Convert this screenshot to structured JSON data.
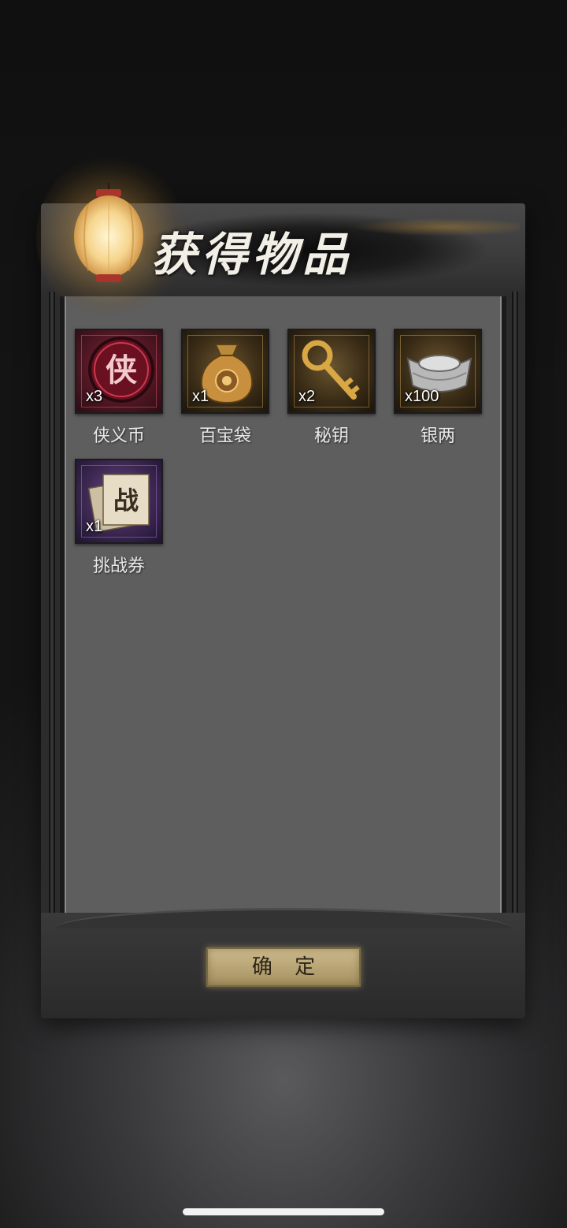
{
  "dialog": {
    "title": "获得物品",
    "confirm_label": "确 定"
  },
  "items": [
    {
      "name": "侠义币",
      "count": "x3",
      "tile": "red",
      "icon": "xia-coin-icon",
      "glyph": "侠"
    },
    {
      "name": "百宝袋",
      "count": "x1",
      "tile": "gold",
      "icon": "treasure-bag-icon"
    },
    {
      "name": "秘钥",
      "count": "x2",
      "tile": "gold",
      "icon": "key-icon"
    },
    {
      "name": "银两",
      "count": "x100",
      "tile": "gold",
      "icon": "silver-ingot-icon"
    },
    {
      "name": "挑战券",
      "count": "x1",
      "tile": "purple",
      "icon": "challenge-ticket-icon",
      "glyph": "战"
    }
  ]
}
